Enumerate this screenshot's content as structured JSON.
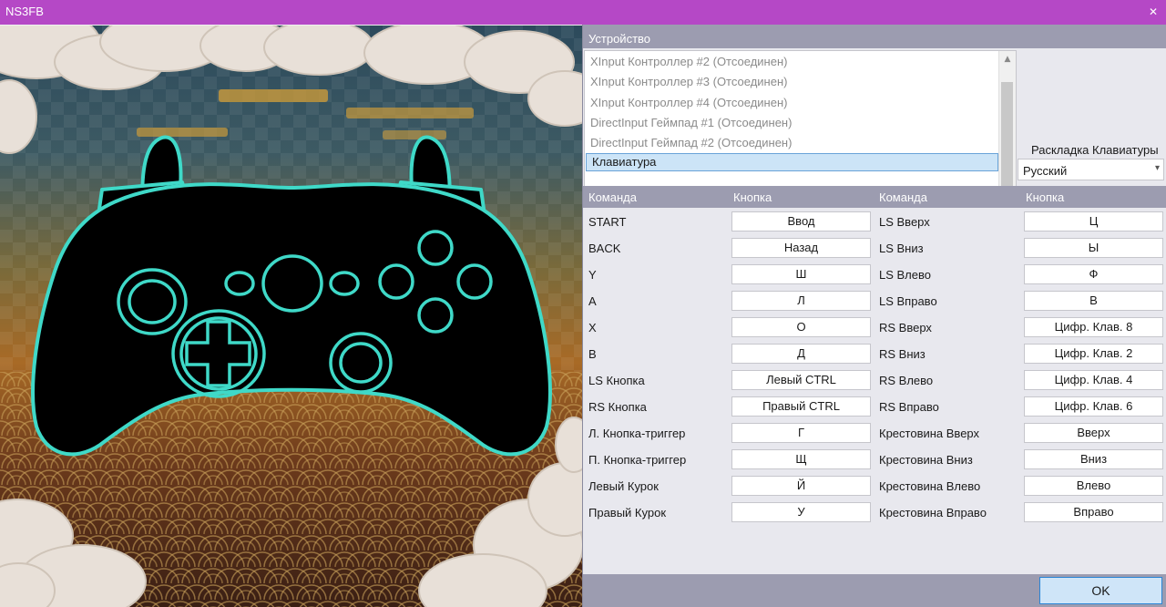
{
  "window": {
    "title": "NS3FB",
    "close_glyph": "✕"
  },
  "device_section": {
    "header": "Устройство",
    "devices": [
      "XInput Контроллер #2 (Отсоединен)",
      "XInput Контроллер #3 (Отсоединен)",
      "XInput Контроллер #4 (Отсоединен)",
      "DirectInput Геймпад #1 (Отсоединен)",
      "DirectInput Геймпад #2 (Отсоединен)",
      "Клавиатура"
    ],
    "selected_index": 5,
    "scroll_up": "▲",
    "scroll_down": "▼"
  },
  "keyboard_layout": {
    "label": "Раскладка Клавиатуры",
    "value": "Русский",
    "chevron": "▾"
  },
  "table": {
    "headers": [
      "Команда",
      "Кнопка",
      "Команда",
      "Кнопка"
    ],
    "rows": [
      {
        "cmd1": "START",
        "key1": "Ввод",
        "cmd2": "LS Вверх",
        "key2": "Ц"
      },
      {
        "cmd1": "BACK",
        "key1": "Назад",
        "cmd2": "LS Вниз",
        "key2": "Ы"
      },
      {
        "cmd1": "Y",
        "key1": "Ш",
        "cmd2": "LS Влево",
        "key2": "Ф"
      },
      {
        "cmd1": "A",
        "key1": "Л",
        "cmd2": "LS Вправо",
        "key2": "В"
      },
      {
        "cmd1": "X",
        "key1": "О",
        "cmd2": "RS Вверх",
        "key2": "Цифр. Клав. 8"
      },
      {
        "cmd1": "B",
        "key1": "Д",
        "cmd2": "RS Вниз",
        "key2": "Цифр. Клав. 2"
      },
      {
        "cmd1": "LS Кнопка",
        "key1": "Левый CTRL",
        "cmd2": "RS Влево",
        "key2": "Цифр. Клав. 4"
      },
      {
        "cmd1": "RS Кнопка",
        "key1": "Правый CTRL",
        "cmd2": "RS Вправо",
        "key2": "Цифр. Клав. 6"
      },
      {
        "cmd1": "Л. Кнопка-триггер",
        "key1": "Г",
        "cmd2": "Крестовина Вверх",
        "key2": "Вверх"
      },
      {
        "cmd1": "П. Кнопка-триггер",
        "key1": "Щ",
        "cmd2": "Крестовина Вниз",
        "key2": "Вниз"
      },
      {
        "cmd1": "Левый Курок",
        "key1": "Й",
        "cmd2": "Крестовина Влево",
        "key2": "Влево"
      },
      {
        "cmd1": "Правый Курок",
        "key1": "У",
        "cmd2": "Крестовина Вправо",
        "key2": "Вправо"
      }
    ]
  },
  "footer": {
    "ok_label": "OK"
  },
  "colors": {
    "titlebar": "#b548c6",
    "header_bar": "#9c9cb0",
    "panel_bg": "#e8e8ee",
    "controller_outline": "#3fd9c8",
    "selection_bg": "#cce4f7",
    "ok_border": "#2b85d6"
  }
}
